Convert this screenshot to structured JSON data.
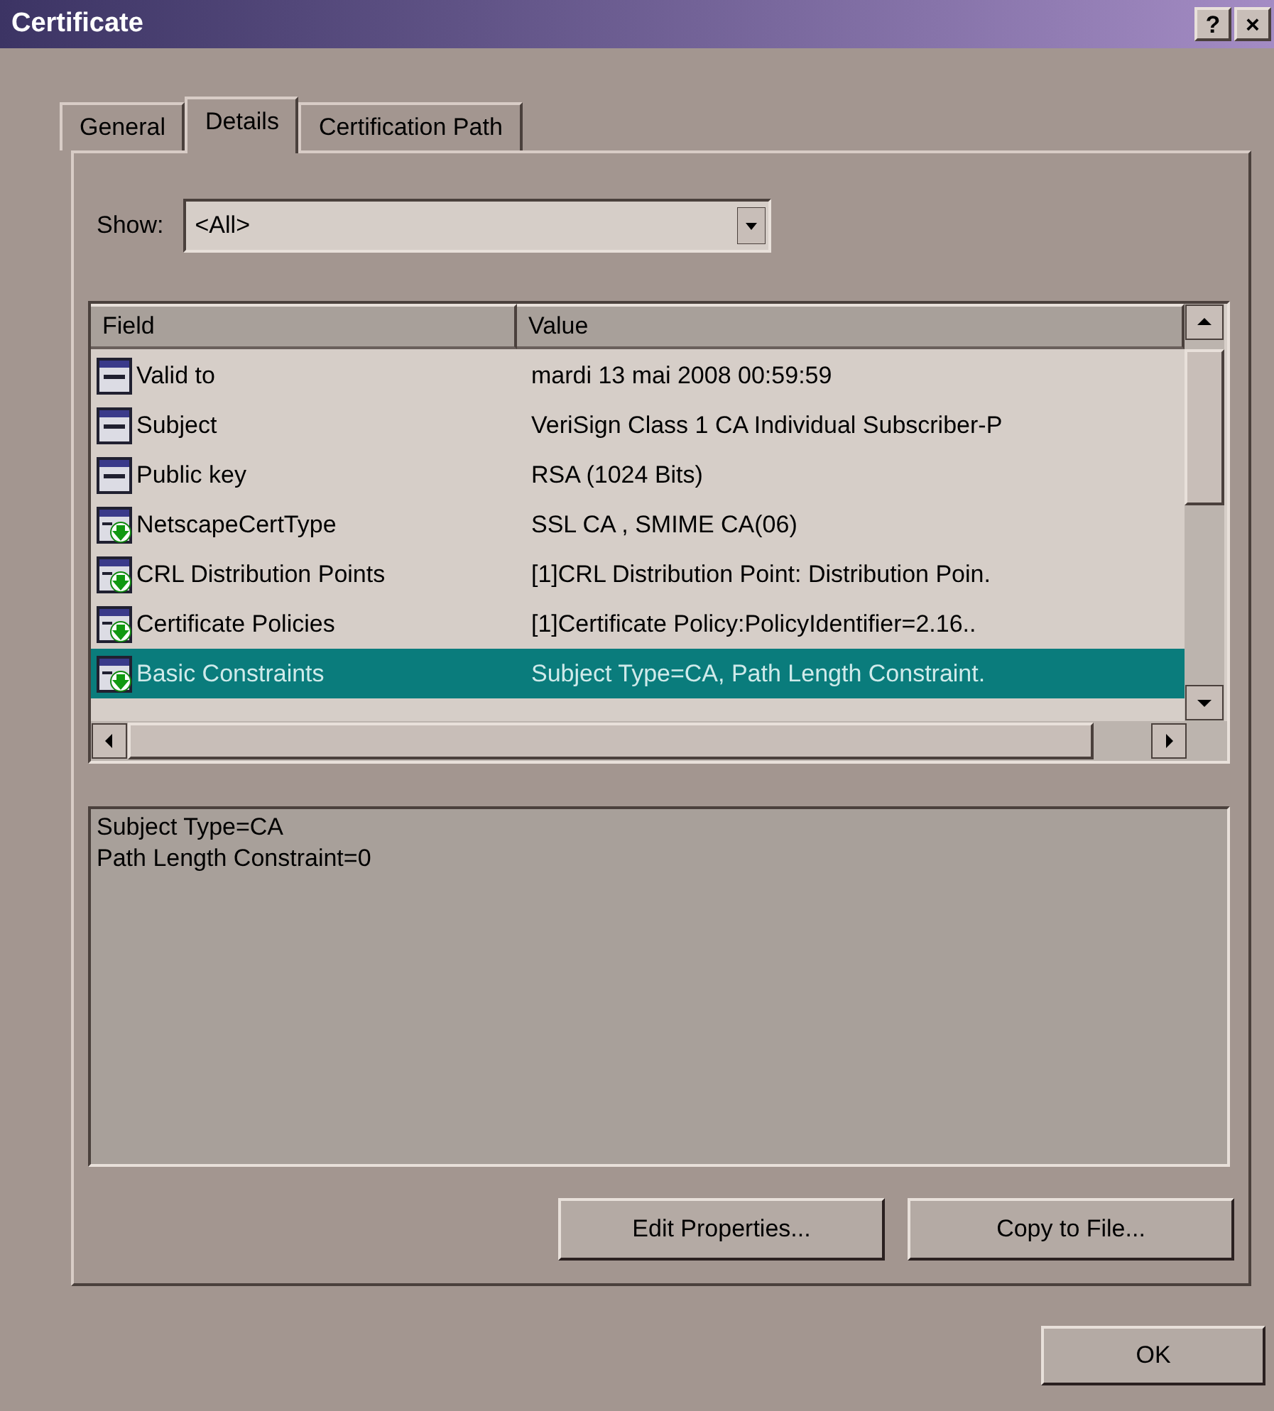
{
  "window": {
    "title": "Certificate",
    "buttons": [
      "?",
      "×"
    ]
  },
  "tabs": [
    {
      "label": "General",
      "selected": false
    },
    {
      "label": "Details",
      "selected": true
    },
    {
      "label": "Certification Path",
      "selected": false
    }
  ],
  "show": {
    "label": "Show:",
    "value": "<All>"
  },
  "table": {
    "columns": [
      "Field",
      "Value"
    ],
    "rows": [
      {
        "kind": "plain",
        "field": "Valid to",
        "value": "mardi 13 mai 2008 00:59:59",
        "selected": false
      },
      {
        "kind": "plain",
        "field": "Subject",
        "value": "VeriSign Class 1 CA Individual Subscriber-P",
        "selected": false
      },
      {
        "kind": "plain",
        "field": "Public key",
        "value": "RSA (1024 Bits)",
        "selected": false
      },
      {
        "kind": "extension",
        "field": "NetscapeCertType",
        "value": "SSL CA , SMIME CA(06)",
        "selected": false
      },
      {
        "kind": "extension",
        "field": "CRL Distribution Points",
        "value": "[1]CRL Distribution Point: Distribution Poin.",
        "selected": false
      },
      {
        "kind": "extension",
        "field": "Certificate Policies",
        "value": "[1]Certificate Policy:PolicyIdentifier=2.16..",
        "selected": false
      },
      {
        "kind": "extension",
        "field": "Basic Constraints",
        "value": "Subject Type=CA, Path Length Constraint.",
        "selected": true
      }
    ]
  },
  "detail_text": [
    "Subject Type=CA",
    "Path Length Constraint=0"
  ],
  "buttons": [
    "Edit Properties...",
    "Copy to File..."
  ],
  "footer_buttons": [
    "OK"
  ]
}
